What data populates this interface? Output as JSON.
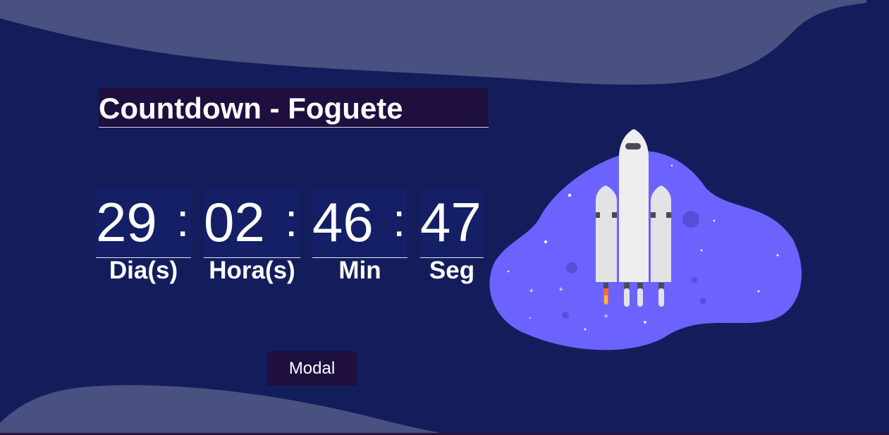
{
  "page": {
    "title": "Countdown - Foguete"
  },
  "countdown": {
    "days": {
      "value": "29",
      "label": "Dia(s)"
    },
    "hours": {
      "value": "02",
      "label": "Hora(s)"
    },
    "minutes": {
      "value": "46",
      "label": "Min"
    },
    "seconds": {
      "value": "47",
      "label": "Seg"
    },
    "separator": ":"
  },
  "actions": {
    "modal_label": "Modal"
  },
  "theme": {
    "background": "#131d5c",
    "wave": "#485180",
    "title_bg": "#1f0f3f",
    "blob": "#6c63ff",
    "rocket_body": "#eeeeee"
  },
  "illustration": {
    "icon": "rocket-illustration"
  }
}
